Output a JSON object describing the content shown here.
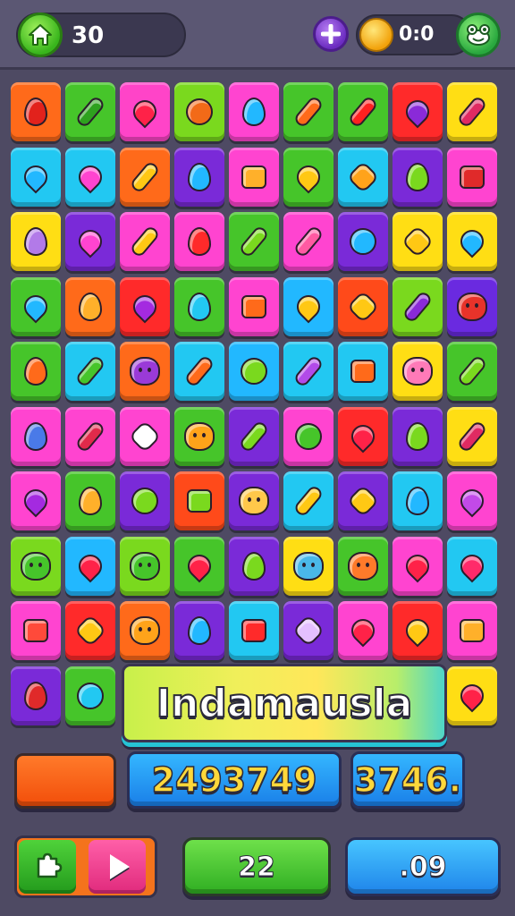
{
  "hud": {
    "score": "30",
    "coins": "0:0",
    "icons": {
      "home": "home-icon",
      "plus": "plus-icon",
      "coin": "coin-icon",
      "settings": "frog-settings-icon"
    }
  },
  "board": {
    "rows": 10,
    "cols": 9,
    "tiles": [
      [
        "#ff6a1a:egg:#e2221c",
        "#46c52a:pill:#2ea11e",
        "#ff44c8:heart:#ff2248",
        "#7ad91e:round:#f26a18",
        "#ff44d0:egg:#22b8ff",
        "#46c52a:pill:#ff6a1a",
        "#46c52a:pill:#ff2020",
        "#ff2a2a:heart:#8a2ad8",
        "#ffde14:pill:#e02a62"
      ],
      [
        "#22c8f2:heart:#22b8ff",
        "#22c8f2:heart:#ff44d0",
        "#ff6a1a:pill:#ffc814",
        "#7a2ad8:egg:#22b8ff",
        "#ff44d0:square:#ffb02a",
        "#46c52a:heart:#ffc814",
        "#22c8f2:star:#ffa31a",
        "#7a2ad8:egg:#7ad91e",
        "#ff44d0:square:#e02a2a"
      ],
      [
        "#ffde14:egg:#b27ae8",
        "#7a2ad8:heart:#ff44d0",
        "#ff44d0:pill:#ffc814",
        "#ff44d0:egg:#ff2a2a",
        "#46c52a:pill:#7ad91e",
        "#ff44d0:pill:#ff5aa2",
        "#7a2ad8:round:#22b8ff",
        "#ffde14:star:#ffc814",
        "#ffde14:heart:#22b8ff"
      ],
      [
        "#46c52a:heart:#22b8ff",
        "#ff6a1a:egg:#ffb02a",
        "#ff2a2a:heart:#a42ae0",
        "#46c52a:egg:#22c8f2",
        "#ff44d0:square:#ff6a1a",
        "#22b8ff:heart:#ffc814",
        "#ff4a1a:star:#ffc814",
        "#7ad91e:pill:#8a2ad8",
        "#6a2ae0:face:#e8332a"
      ],
      [
        "#46c52a:egg:#ff6a1a",
        "#22c8f2:pill:#46c52a",
        "#ff6a1a:face:#9a3ad8",
        "#22c8f2:pill:#ff6a1a",
        "#22b8ff:round:#7ad91e",
        "#22c8f2:pill:#b24ae8",
        "#22c8f2:square:#ff6a1a",
        "#ffde14:face:#ff7ab8",
        "#46c52a:pill:#7ad91e"
      ],
      [
        "#ff44d0:egg:#4a7ae8",
        "#ff44d0:pill:#e02a4a",
        "#ff44d0:star:#ffffff",
        "#46c52a:face:#ffa31a",
        "#7a2ad8:pill:#7ad91e",
        "#ff44d0:round:#46c52a",
        "#ff2a2a:heart:#ff2248",
        "#7a2ad8:egg:#7ad91e",
        "#ffde14:pill:#e02a62"
      ],
      [
        "#ff44d0:heart:#a42ae0",
        "#46c52a:egg:#ffb02a",
        "#7a2ad8:round:#7ad91e",
        "#ff4a1a:square:#7ad91e",
        "#7a2ad8:face:#ffc84a",
        "#22c8f2:pill:#ffc814",
        "#7a2ad8:star:#ffc814",
        "#22c8f2:egg:#22b8ff",
        "#ff44d0:heart:#c24ae8"
      ],
      [
        "#7ad91e:face:#46c52a",
        "#22b8ff:heart:#ff2248",
        "#7ad91e:face:#46c52a",
        "#46c52a:heart:#ff2248",
        "#7a2ad8:egg:#7ad91e",
        "#ffde14:face:#4ab8e8",
        "#46c52a:face:#ff7a2a",
        "#ff44d0:heart:#ff2248",
        "#22c8f2:heart:#ff2a6a"
      ],
      [
        "#ff44d0:square:#ff4a3a",
        "#ff2a2a:star:#ffc814",
        "#ff6a1a:face:#ffa31a",
        "#7a2ad8:egg:#22b8ff",
        "#22c8f2:square:#ff2a2a",
        "#7a2ad8:star:#e4c0ff",
        "#ff44d0:heart:#ff2248",
        "#ff2a2a:heart:#ffc814",
        "#ff44d0:square:#ffb02a"
      ],
      [
        "#7a2ad8:egg:#e02a2a",
        "#46c52a:round:#22c8f2",
        "",
        "",
        "",
        "",
        "",
        "",
        "#ffde14:heart:#ff2248"
      ]
    ]
  },
  "banner": {
    "title": "Indamausla"
  },
  "counters": {
    "primary": "2493749",
    "secondary": "3746."
  },
  "bottom": {
    "green_label": "22",
    "blue_label": ".09",
    "icons": {
      "puzzle": "puzzle-icon",
      "play": "play-icon"
    }
  },
  "colors": {
    "background": "#4e4a63",
    "accent_green": "#38b51c",
    "accent_blue": "#1f84ea",
    "accent_orange": "#f4731c"
  }
}
